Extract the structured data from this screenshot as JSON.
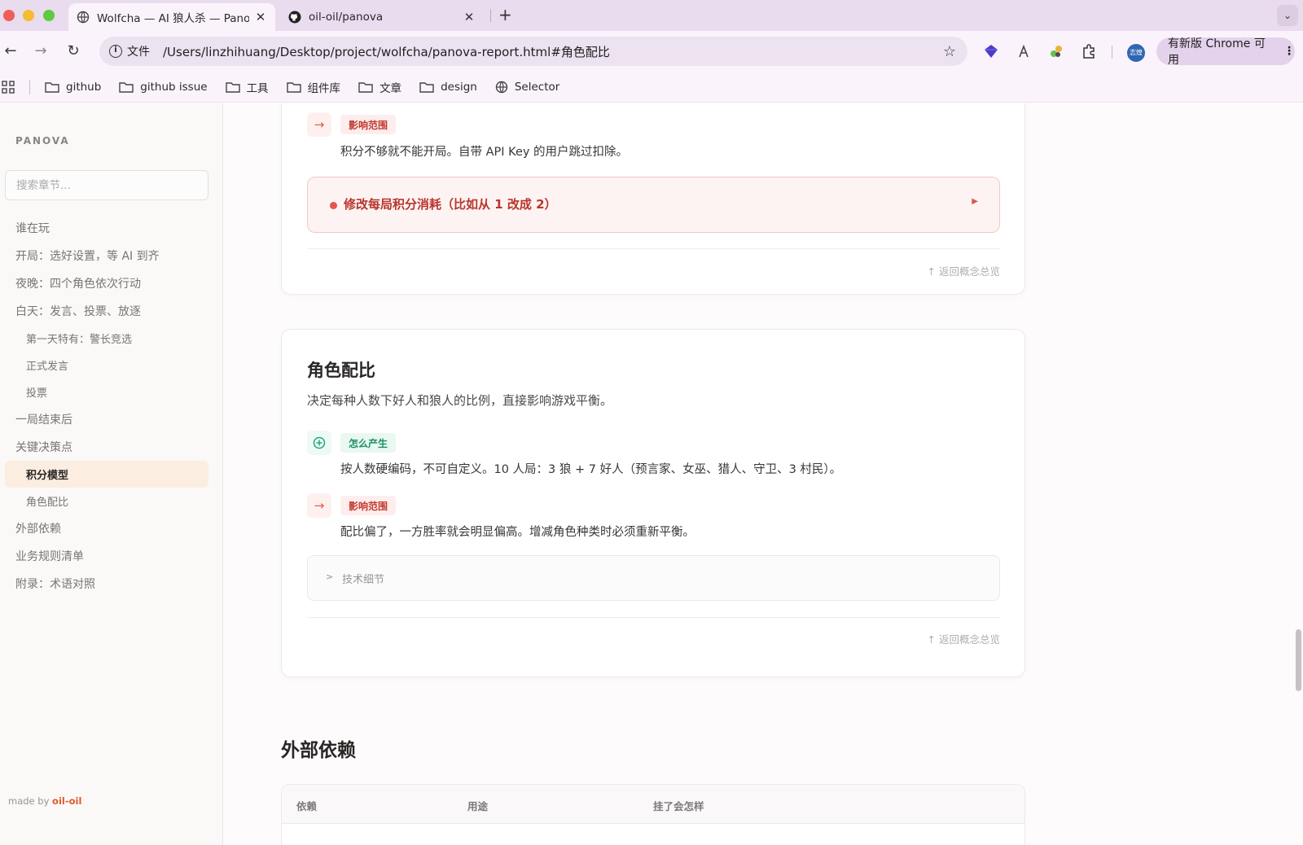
{
  "browser": {
    "tabs": [
      {
        "title": "Wolfcha — AI 狼人杀 — Panova",
        "active": true
      },
      {
        "title": "oil-oil/panova",
        "active": false
      }
    ],
    "omnibox_chip": "文件",
    "url": "/Users/linzhihuang/Desktop/project/wolfcha/panova-report.html#角色配比",
    "avatar_text": "志煌",
    "update_label": "有新版 Chrome 可用",
    "bookmarks": [
      "github",
      "github issue",
      "工具",
      "组件库",
      "文章",
      "design",
      "Selector"
    ]
  },
  "sidebar": {
    "brand": "PANOVA",
    "search_placeholder": "搜索章节...",
    "items": [
      {
        "label": "谁在玩"
      },
      {
        "label": "开局：选好设置，等 AI 到齐"
      },
      {
        "label": "夜晚：四个角色依次行动"
      },
      {
        "label": "白天：发言、投票、放逐"
      },
      {
        "label": "第一天特有：警长竞选"
      },
      {
        "label": "正式发言"
      },
      {
        "label": "投票"
      },
      {
        "label": "一局结束后"
      },
      {
        "label": "关键决策点"
      },
      {
        "label": "积分模型"
      },
      {
        "label": "角色配比"
      },
      {
        "label": "外部依赖"
      },
      {
        "label": "业务规则清单"
      },
      {
        "label": "附录：术语对照"
      }
    ],
    "made_by_prefix": "made by ",
    "made_by_name": "oil-oil"
  },
  "card1": {
    "impact_tag": "影响范围",
    "impact_text": "积分不够就不能开局。自带 API Key 的用户跳过扣除。",
    "alert_text": "修改每局积分消耗（比如从 1 改成 2）",
    "back_link": "↑ 返回概念总览"
  },
  "card2": {
    "title": "角色配比",
    "desc": "决定每种人数下好人和狼人的比例，直接影响游戏平衡。",
    "origin_tag": "怎么产生",
    "origin_text": "按人数硬编码，不可自定义。10 人局：3 狼 + 7 好人（预言家、女巫、猎人、守卫、3 村民）。",
    "impact_tag": "影响范围",
    "impact_text": "配比偏了，一方胜率就会明显偏高。增减角色种类时必须重新平衡。",
    "tech_label": "技术细节",
    "back_link": "↑ 返回概念总览"
  },
  "deps": {
    "title": "外部依赖",
    "headers": [
      "依赖",
      "用途",
      "挂了会怎样"
    ]
  },
  "colors": {
    "accent_orange": "#e05a2a",
    "alert_red": "#b8362d",
    "tag_green": "#1f8f65",
    "active_nav_bg": "#fbeee0"
  }
}
